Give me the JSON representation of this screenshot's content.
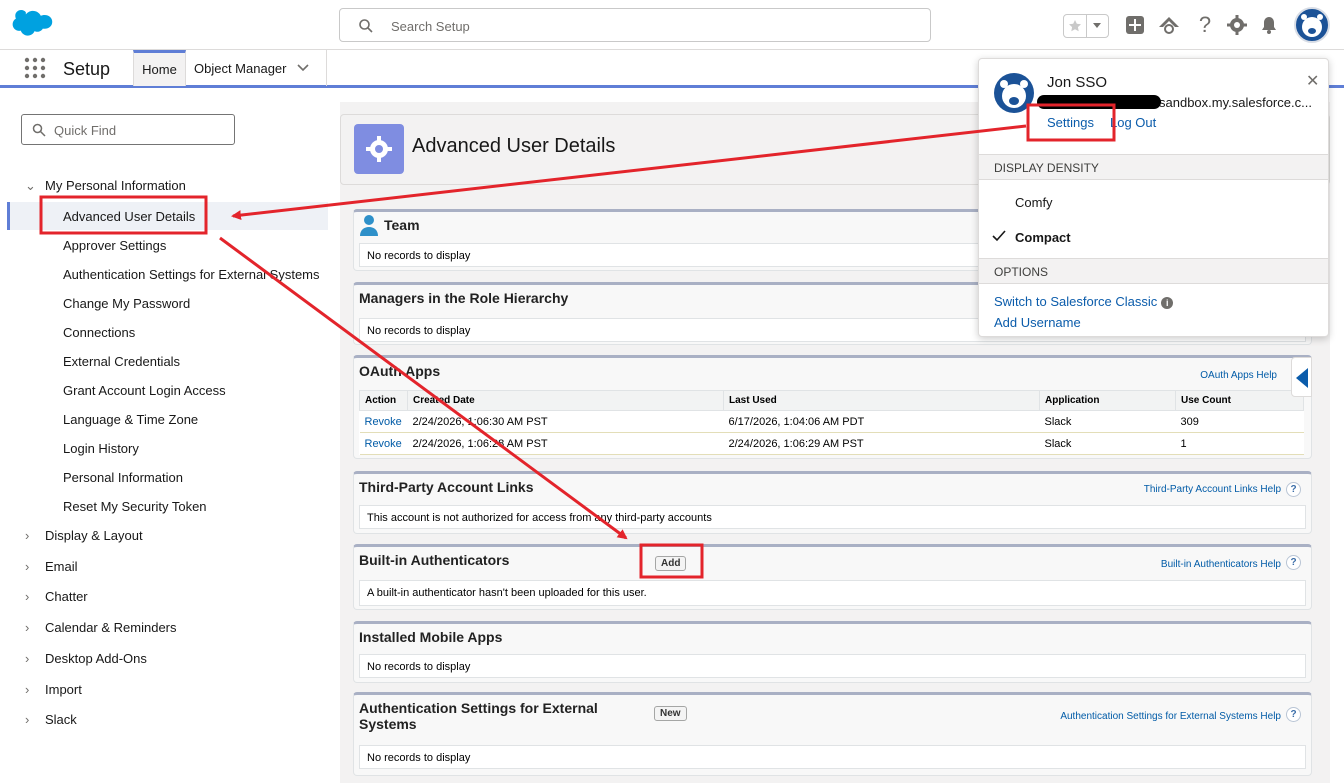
{
  "header": {
    "search_placeholder": "Search Setup",
    "app_name": "Setup",
    "tabs": [
      {
        "label": "Home"
      },
      {
        "label": "Object Manager"
      }
    ]
  },
  "sidebar": {
    "quickfind_placeholder": "Quick Find",
    "group_open": "My Personal Information",
    "items": [
      "Advanced User Details",
      "Approver Settings",
      "Authentication Settings for External Systems",
      "Change My Password",
      "Connections",
      "External Credentials",
      "Grant Account Login Access",
      "Language & Time Zone",
      "Login History",
      "Personal Information",
      "Reset My Security Token"
    ],
    "groups": [
      "Display & Layout",
      "Email",
      "Chatter",
      "Calendar & Reminders",
      "Desktop Add-Ons",
      "Import",
      "Slack"
    ]
  },
  "page": {
    "title": "Advanced User Details",
    "team": {
      "title": "Team",
      "empty": "No records to display"
    },
    "managers": {
      "title": "Managers in the Role Hierarchy",
      "empty": "No records to display"
    },
    "oauth": {
      "title": "OAuth Apps",
      "help": "OAuth Apps Help",
      "columns": [
        "Action",
        "Created Date",
        "Last Used",
        "Application",
        "Use Count"
      ],
      "rows": [
        {
          "action": "Revoke",
          "created": "2/24/2026, 1:06:30 AM PST",
          "last_used": "6/17/2026, 1:04:06 AM PDT",
          "app": "Slack",
          "count": "309"
        },
        {
          "action": "Revoke",
          "created": "2/24/2026, 1:06:28 AM PST",
          "last_used": "2/24/2026, 1:06:29 AM PST",
          "app": "Slack",
          "count": "1"
        }
      ]
    },
    "third_party": {
      "title": "Third-Party Account Links",
      "help": "Third-Party Account Links Help",
      "body": "This account is not authorized for access from any third-party accounts"
    },
    "builtin": {
      "title": "Built-in Authenticators",
      "button": "Add",
      "help": "Built-in Authenticators Help",
      "body": "A built-in authenticator hasn't been uploaded for this user."
    },
    "mobile": {
      "title": "Installed Mobile Apps",
      "empty": "No records to display"
    },
    "auth_ext": {
      "title": "Authentication Settings for External Systems",
      "button": "New",
      "help": "Authentication Settings for External Systems Help",
      "empty": "No records to display"
    }
  },
  "user_panel": {
    "name": "Jon SSO",
    "domain": "sandbox.my.salesforce.c...",
    "settings": "Settings",
    "logout": "Log Out",
    "density_header": "DISPLAY DENSITY",
    "comfy": "Comfy",
    "compact": "Compact",
    "options_header": "OPTIONS",
    "switch_classic": "Switch to Salesforce Classic",
    "add_username": "Add Username"
  },
  "colors": {
    "brand": "#00a1e0",
    "accent": "#5f7ed6",
    "annotation": "#e3242b"
  }
}
